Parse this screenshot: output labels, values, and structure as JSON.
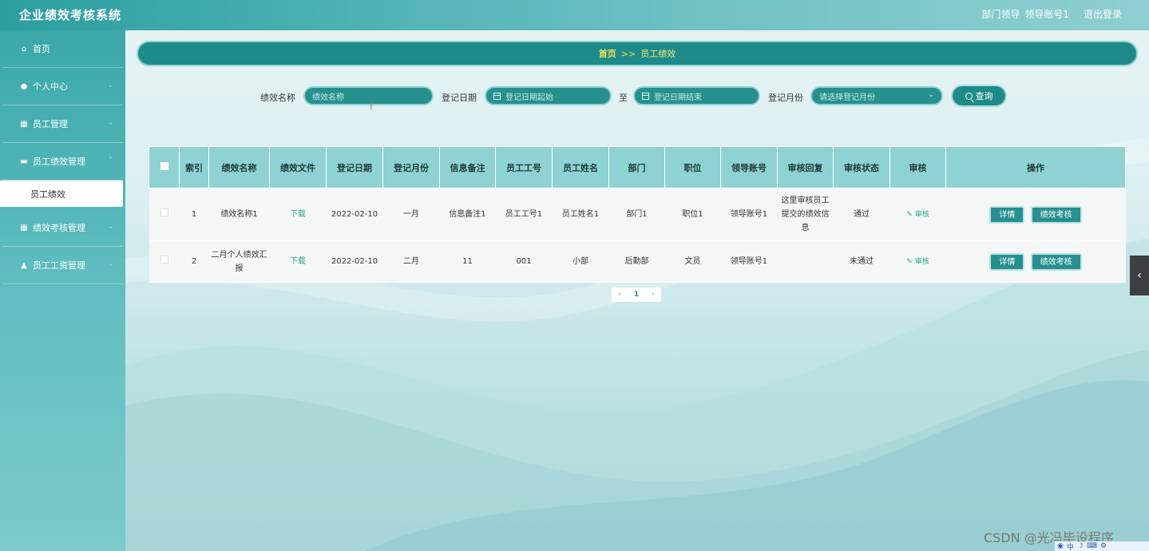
{
  "app": {
    "title": "企业绩效考核系统"
  },
  "header": {
    "role": "部门领导",
    "account": "领导账号1",
    "logout": "退出登录"
  },
  "sidebar": {
    "items": [
      {
        "label": "首页",
        "icon": "home-icon"
      },
      {
        "label": "个人中心",
        "icon": "user-icon"
      },
      {
        "label": "员工管理",
        "icon": "grid-icon"
      },
      {
        "label": "员工绩效管理",
        "icon": "chat-icon"
      },
      {
        "label": "绩效考核管理",
        "icon": "grid-icon"
      },
      {
        "label": "员工工资管理",
        "icon": "bank-icon"
      }
    ],
    "submenu_active": "员工绩效"
  },
  "breadcrumb": {
    "home": "首页",
    "sep": ">>",
    "current": "员工绩效"
  },
  "search": {
    "name_label": "绩效名称",
    "name_placeholder": "绩效名称",
    "date_label": "登记日期",
    "date_start_placeholder": "登记日期起始",
    "to_label": "至",
    "date_end_placeholder": "登记日期结束",
    "month_label": "登记月份",
    "month_placeholder": "请选择登记月份",
    "query_label": "查询"
  },
  "table": {
    "headers": [
      "索引",
      "绩效名称",
      "绩效文件",
      "登记日期",
      "登记月份",
      "信息备注",
      "员工工号",
      "员工姓名",
      "部门",
      "职位",
      "领导账号",
      "审核回复",
      "审核状态",
      "审核",
      "操作"
    ],
    "rows": [
      {
        "index": "1",
        "name": "绩效名称1",
        "file": "下载",
        "date": "2022-02-10",
        "month": "一月",
        "note": "信息备注1",
        "emp_no": "员工工号1",
        "emp_name": "员工姓名1",
        "dept": "部门1",
        "position": "职位1",
        "leader": "领导账号1",
        "reply": "这里审核员工提交的绩效信息",
        "status": "通过",
        "audit": "审核",
        "btn_detail": "详情",
        "btn_review": "绩效考核"
      },
      {
        "index": "2",
        "name": "二月个人绩效汇报",
        "file": "下载",
        "date": "2022-02-10",
        "month": "二月",
        "note": "11",
        "emp_no": "001",
        "emp_name": "小部",
        "dept": "后勤部",
        "position": "文员",
        "leader": "领导账号1",
        "reply": "",
        "status": "未通过",
        "audit": "审核",
        "btn_detail": "详情",
        "btn_review": "绩效考核"
      }
    ]
  },
  "pagination": {
    "current": "1"
  },
  "watermark": "CSDN @光冯毕设程序",
  "tray": {
    "lang": "中"
  },
  "colors": {
    "accent": "#1e8b8a",
    "header_bg": "#8fd2d3",
    "breadcrumb_text": "#f7e15a",
    "link": "#2aa68a"
  }
}
